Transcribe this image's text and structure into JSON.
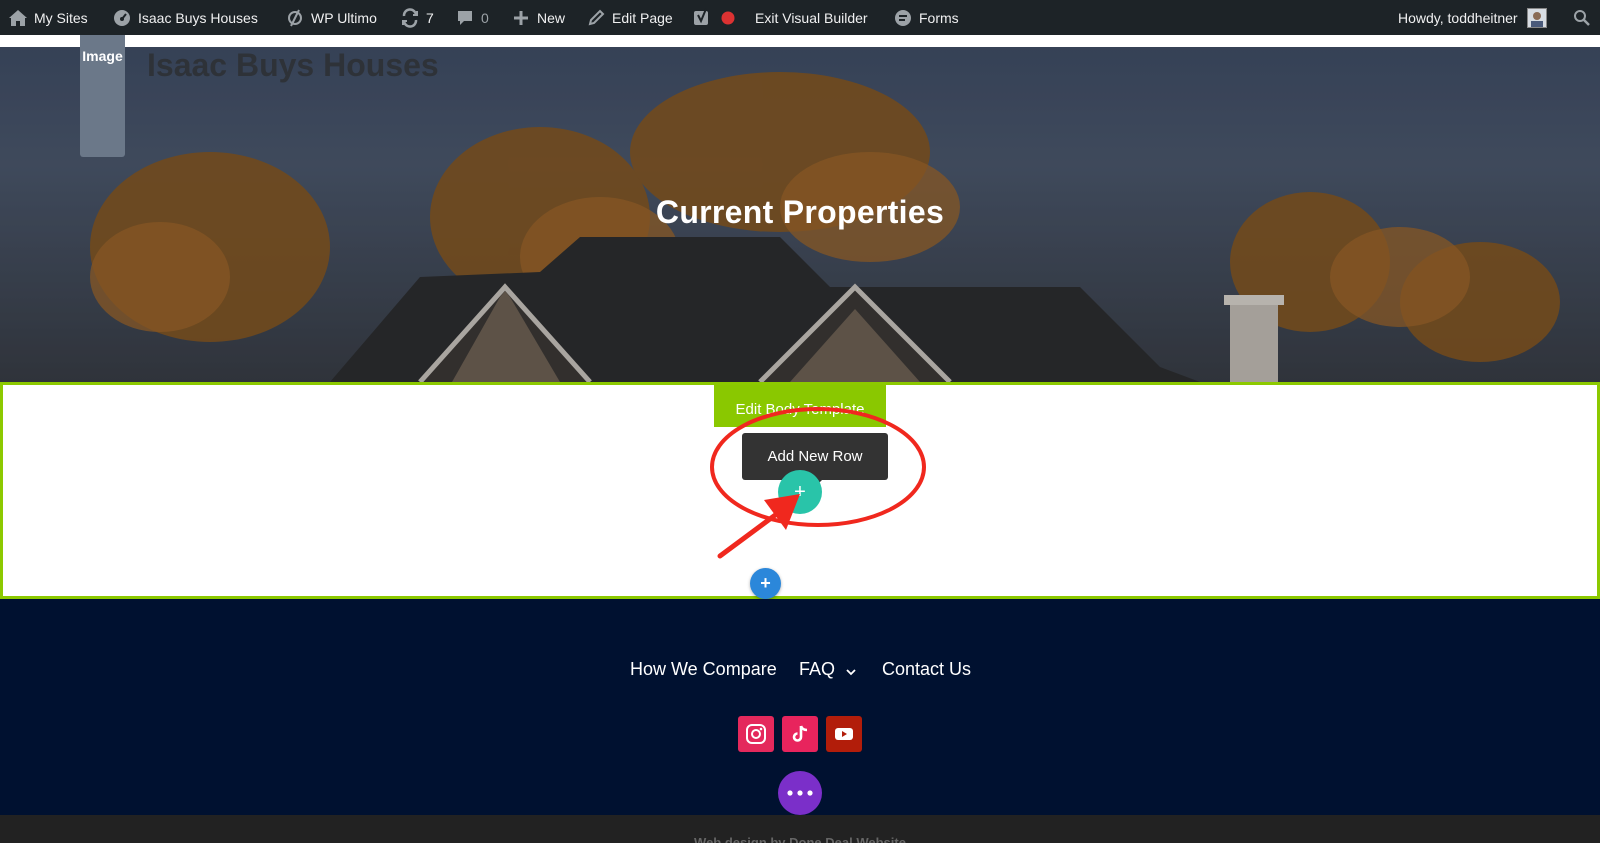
{
  "adminbar": {
    "my_sites": "My Sites",
    "site_name": "Isaac Buys Houses",
    "wp_ultimo": "WP Ultimo",
    "updates_count": "7",
    "comments_count": "0",
    "new_label": "New",
    "edit_page": "Edit Page",
    "exit_builder": "Exit Visual Builder",
    "forms": "Forms",
    "howdy": "Howdy, toddheitner"
  },
  "header": {
    "logo_placeholder": "Image",
    "site_title": "Isaac Buys Houses"
  },
  "hero": {
    "heading": "Current Properties"
  },
  "builder": {
    "edit_body_template": "Edit Body Template",
    "add_new_row_tooltip": "Add New Row",
    "add_row_symbol": "+",
    "add_section_symbol": "+"
  },
  "footer": {
    "nav": [
      "How We Compare",
      "FAQ",
      "Contact Us"
    ],
    "social_icons": [
      "instagram-icon",
      "tiktok-icon",
      "youtube-icon"
    ],
    "credit": "Web design by Done Deal Website"
  },
  "colors": {
    "admin_bar": "#1d2327",
    "builder_green": "#8ac800",
    "add_row_teal": "#29c4a9",
    "add_section_blue": "#2b87da",
    "footer_navy": "#001130",
    "instagram": "#e4295c",
    "tiktok": "#e8245d",
    "youtube": "#b21d0a",
    "annotation_red": "#f0281e",
    "more_purple": "#7b2fc9"
  }
}
